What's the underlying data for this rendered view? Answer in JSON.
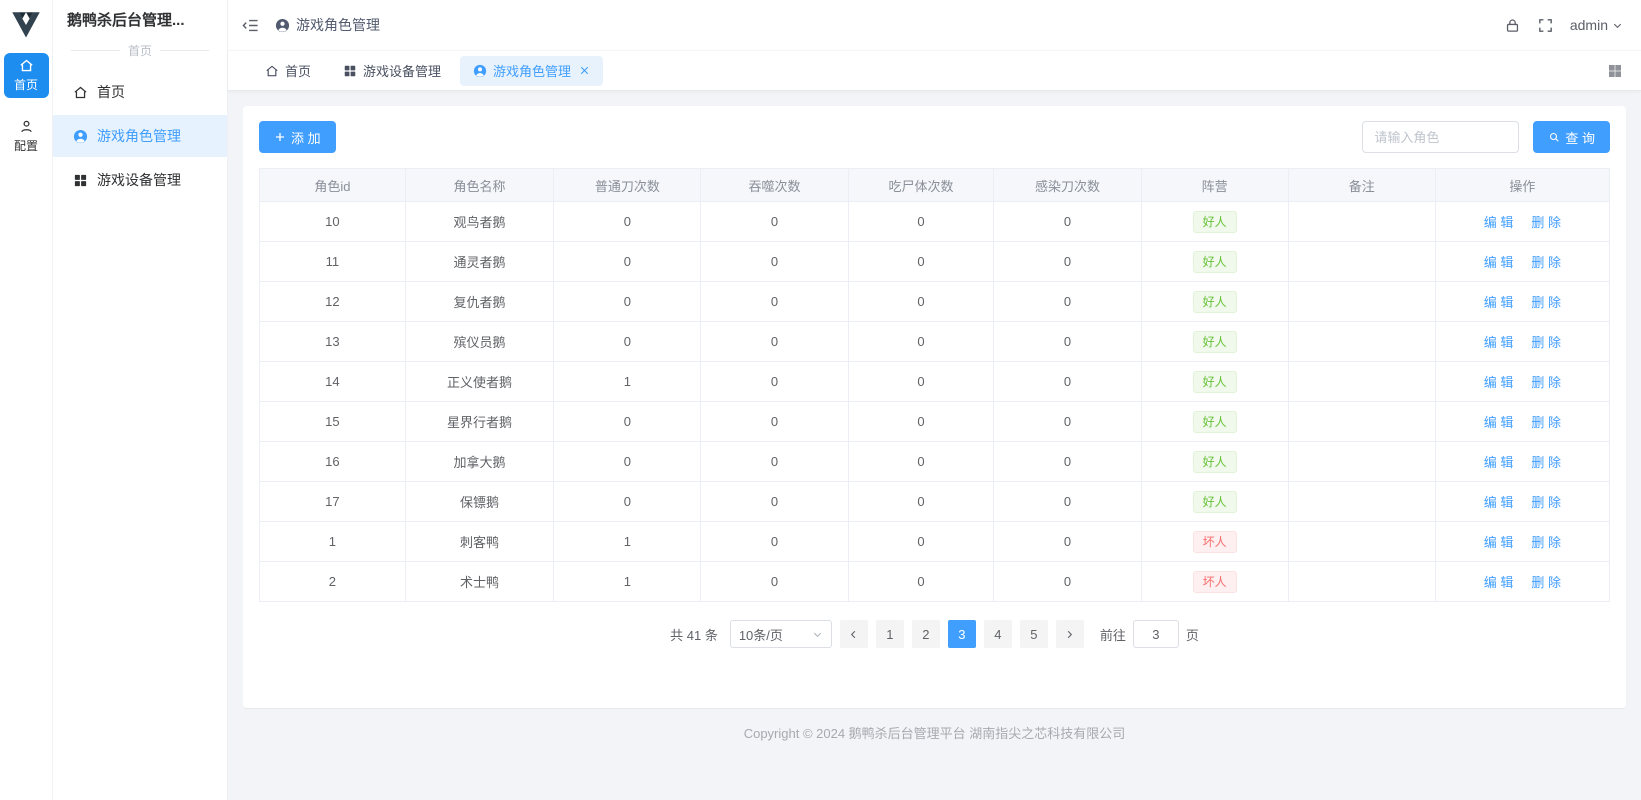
{
  "app": {
    "title": "鹅鸭杀后台管理..."
  },
  "colors": {
    "accent": "#409eff",
    "rail_active": "#1e8df0",
    "good_tag_text": "#67c23a",
    "good_tag_bg": "#f0f9eb",
    "bad_tag_text": "#f56c6c",
    "bad_tag_bg": "#fef0f0"
  },
  "icons": {
    "logo": "v-mark",
    "home": "house",
    "user": "person-in-circle",
    "grid": "four-squares",
    "config": "person",
    "lock": "padlock",
    "fullscreen": "corner-brackets",
    "caret": "chevron-down",
    "fold": "menu-fold",
    "search": "magnifier",
    "plus": "+",
    "close": "×"
  },
  "rail": {
    "items": [
      {
        "label": "首页",
        "active": true
      },
      {
        "label": "配置",
        "active": false
      }
    ]
  },
  "sidebar": {
    "title": "鹅鸭杀后台管理...",
    "divider": "首页",
    "items": [
      {
        "label": "首页",
        "active": false
      },
      {
        "label": "游戏角色管理",
        "active": true
      },
      {
        "label": "游戏设备管理",
        "active": false
      }
    ]
  },
  "header": {
    "breadcrumb": "游戏角色管理",
    "username": "admin"
  },
  "tabs": [
    {
      "label": "首页",
      "active": false,
      "closable": false
    },
    {
      "label": "游戏设备管理",
      "active": false,
      "closable": false
    },
    {
      "label": "游戏角色管理",
      "active": true,
      "closable": true
    }
  ],
  "toolbar": {
    "add_label": "添 加",
    "search_placeholder": "请输入角色",
    "search_label": "查 询"
  },
  "table": {
    "columns": [
      "角色id",
      "角色名称",
      "普通刀次数",
      "吞噬次数",
      "吃尸体次数",
      "感染刀次数",
      "阵营",
      "备注",
      "操作"
    ],
    "edit_label": "编 辑",
    "delete_label": "删 除",
    "rows": [
      {
        "id": "10",
        "name": "观鸟者鹅",
        "normal": "0",
        "devour": "0",
        "eat": "0",
        "infect": "0",
        "camp": "好人",
        "camp_type": "good",
        "remark": ""
      },
      {
        "id": "11",
        "name": "通灵者鹅",
        "normal": "0",
        "devour": "0",
        "eat": "0",
        "infect": "0",
        "camp": "好人",
        "camp_type": "good",
        "remark": ""
      },
      {
        "id": "12",
        "name": "复仇者鹅",
        "normal": "0",
        "devour": "0",
        "eat": "0",
        "infect": "0",
        "camp": "好人",
        "camp_type": "good",
        "remark": ""
      },
      {
        "id": "13",
        "name": "殡仪员鹅",
        "normal": "0",
        "devour": "0",
        "eat": "0",
        "infect": "0",
        "camp": "好人",
        "camp_type": "good",
        "remark": ""
      },
      {
        "id": "14",
        "name": "正义使者鹅",
        "normal": "1",
        "devour": "0",
        "eat": "0",
        "infect": "0",
        "camp": "好人",
        "camp_type": "good",
        "remark": ""
      },
      {
        "id": "15",
        "name": "星界行者鹅",
        "normal": "0",
        "devour": "0",
        "eat": "0",
        "infect": "0",
        "camp": "好人",
        "camp_type": "good",
        "remark": ""
      },
      {
        "id": "16",
        "name": "加拿大鹅",
        "normal": "0",
        "devour": "0",
        "eat": "0",
        "infect": "0",
        "camp": "好人",
        "camp_type": "good",
        "remark": ""
      },
      {
        "id": "17",
        "name": "保镖鹅",
        "normal": "0",
        "devour": "0",
        "eat": "0",
        "infect": "0",
        "camp": "好人",
        "camp_type": "good",
        "remark": ""
      },
      {
        "id": "1",
        "name": "刺客鸭",
        "normal": "1",
        "devour": "0",
        "eat": "0",
        "infect": "0",
        "camp": "坏人",
        "camp_type": "bad",
        "remark": ""
      },
      {
        "id": "2",
        "name": "术士鸭",
        "normal": "1",
        "devour": "0",
        "eat": "0",
        "infect": "0",
        "camp": "坏人",
        "camp_type": "bad",
        "remark": ""
      }
    ]
  },
  "pagination": {
    "total": "共 41 条",
    "page_size": "10条/页",
    "pages": [
      "1",
      "2",
      "3",
      "4",
      "5"
    ],
    "active_page": "3",
    "goto_label": "前往",
    "goto_value": "3",
    "page_word": "页"
  },
  "footer": {
    "copyright": "Copyright © 2024 鹅鸭杀后台管理平台 湖南指尖之芯科技有限公司"
  }
}
